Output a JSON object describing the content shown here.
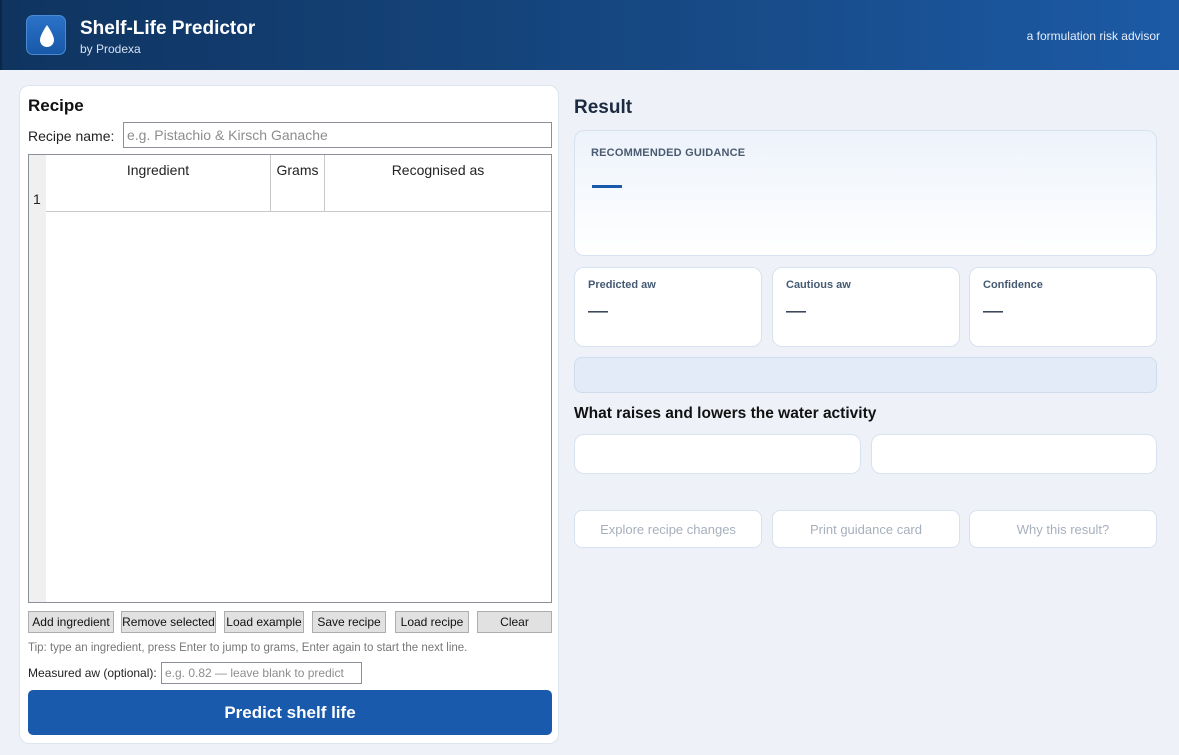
{
  "header": {
    "title": "Shelf-Life Predictor",
    "subtitle": "by Prodexa",
    "tagline": "a formulation risk advisor",
    "logo_icon": "water-drop-icon"
  },
  "recipe": {
    "heading": "Recipe",
    "name_label": "Recipe name:",
    "name_placeholder": "e.g. Pistachio & Kirsch Ganache",
    "name_value": "",
    "columns": [
      "Ingredient",
      "Grams",
      "Recognised as"
    ],
    "rows": [
      {
        "num": "1",
        "ingredient": "",
        "grams": "",
        "recognised": ""
      }
    ],
    "buttons": {
      "add": "Add ingredient",
      "remove": "Remove selected",
      "load_example": "Load example",
      "save": "Save recipe",
      "load": "Load recipe",
      "clear": "Clear"
    },
    "tip": "Tip: type an ingredient, press Enter to jump to grams, Enter again to start the next line.",
    "aw_label": "Measured aw (optional):",
    "aw_placeholder": "e.g. 0.82 — leave blank to predict",
    "aw_value": "",
    "predict_button": "Predict shelf life"
  },
  "result": {
    "heading": "Result",
    "guidance_label": "RECOMMENDED GUIDANCE",
    "metrics": [
      {
        "label": "Predicted aw",
        "value": "—"
      },
      {
        "label": "Cautious aw",
        "value": "—"
      },
      {
        "label": "Confidence",
        "value": "—"
      }
    ],
    "drivers_heading": "What raises and lowers the water activity",
    "actions": {
      "explore": "Explore recipe changes",
      "print": "Print guidance card",
      "why": "Why this result?"
    }
  },
  "colors": {
    "header_start": "#0f3460",
    "header_end": "#1c5aa6",
    "primary": "#1a5aad",
    "background": "#eef2f8"
  }
}
